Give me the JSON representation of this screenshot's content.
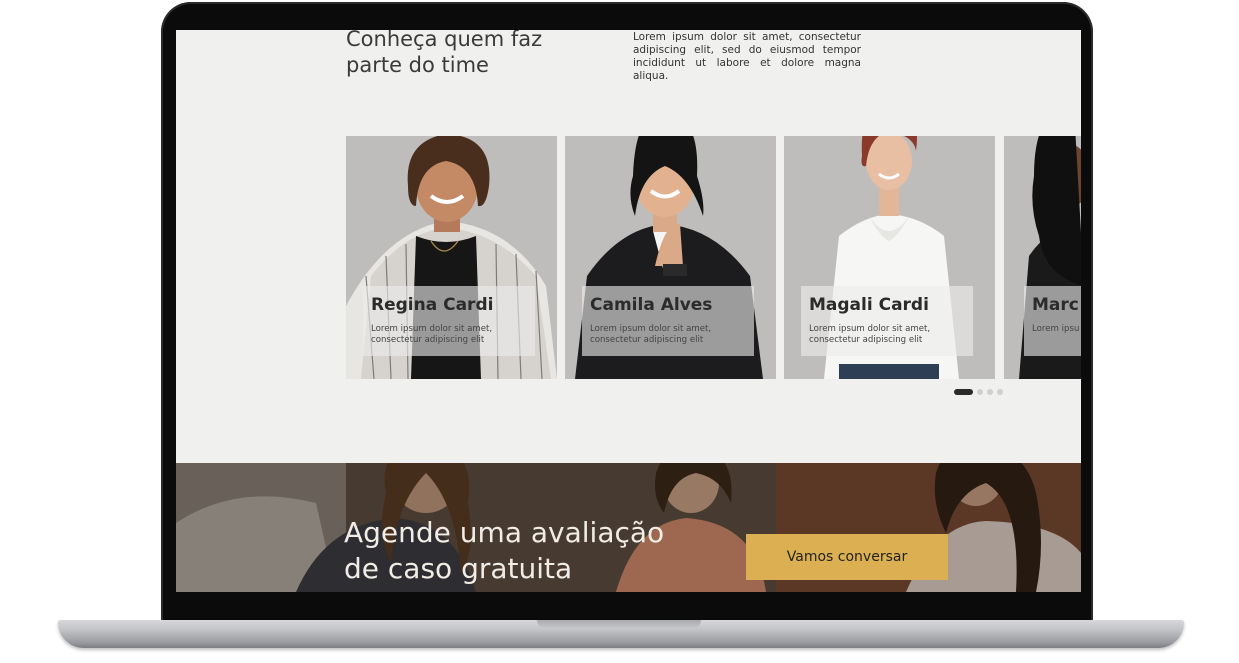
{
  "team": {
    "title_line1": "Conheça quem faz",
    "title_line2": "parte do time",
    "description": "Lorem ipsum dolor sit amet, consectetur adipiscing elit, sed do eiusmod tempor incididunt ut labore et dolore magna aliqua."
  },
  "members": [
    {
      "name": "Regina Cardi",
      "description": "Lorem ipsum dolor sit amet, consectetur adipiscing elit"
    },
    {
      "name": "Camila Alves",
      "description": "Lorem ipsum dolor sit amet, consectetur adipiscing elit"
    },
    {
      "name": "Magali Cardi",
      "description": "Lorem ipsum dolor sit amet, consectetur adipiscing elit"
    },
    {
      "name": "Marc",
      "description": "Lorem ipsu consectetur"
    }
  ],
  "carousel": {
    "pages": 4,
    "active_page": 1
  },
  "cta": {
    "title_line1": "Agende uma avaliação",
    "title_line2": "de caso gratuita",
    "button_label": "Vamos conversar"
  },
  "colors": {
    "accent": "#dcb052",
    "card_background": "#bfbdbb",
    "page_background": "#f0f0ef",
    "laptop_bezel": "#0b0b0b"
  }
}
